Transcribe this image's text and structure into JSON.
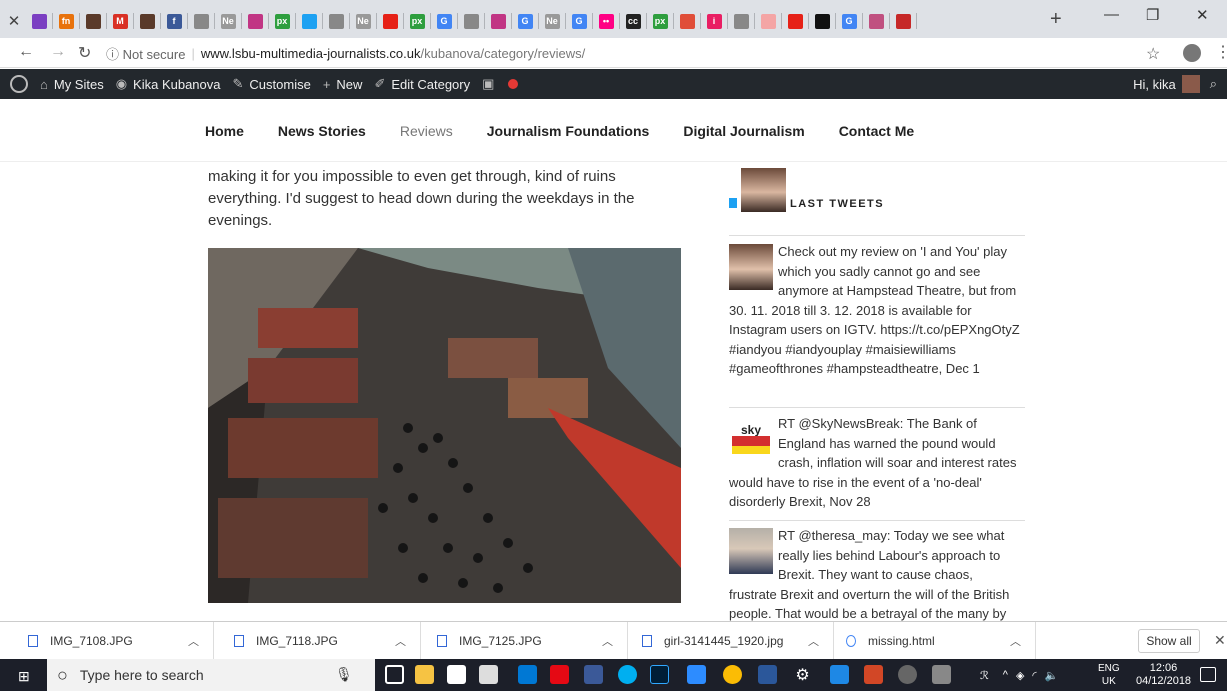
{
  "browser": {
    "tab_icons": [
      {
        "name": "purple-icon",
        "color": "#7b3fc2",
        "glyph": ""
      },
      {
        "name": "fn-icon",
        "color": "#e8720c",
        "glyph": "fn"
      },
      {
        "name": "profile-icon",
        "color": "#5a3a2a",
        "glyph": ""
      },
      {
        "name": "gmail-icon",
        "color": "#d93025",
        "glyph": "M"
      },
      {
        "name": "profile-icon",
        "color": "#5a3a2a",
        "glyph": ""
      },
      {
        "name": "facebook-icon",
        "color": "#3b5998",
        "glyph": "f"
      },
      {
        "name": "doc-icon",
        "color": "#888888",
        "glyph": ""
      },
      {
        "name": "news-icon",
        "color": "#999999",
        "glyph": "Ne"
      },
      {
        "name": "instagram-icon",
        "color": "#c13584",
        "glyph": ""
      },
      {
        "name": "px-icon",
        "color": "#2e9e3e",
        "glyph": "px"
      },
      {
        "name": "twitter-icon",
        "color": "#1da1f2",
        "glyph": ""
      },
      {
        "name": "audio-icon",
        "color": "#888888",
        "glyph": ""
      },
      {
        "name": "news-icon",
        "color": "#999999",
        "glyph": "Ne"
      },
      {
        "name": "youtube-icon",
        "color": "#e62117",
        "glyph": ""
      },
      {
        "name": "px-icon",
        "color": "#2e9e3e",
        "glyph": "px"
      },
      {
        "name": "google-icon",
        "color": "#4285f4",
        "glyph": "G"
      },
      {
        "name": "doc-icon",
        "color": "#888888",
        "glyph": ""
      },
      {
        "name": "instagram-icon",
        "color": "#c13584",
        "glyph": ""
      },
      {
        "name": "google-icon",
        "color": "#4285f4",
        "glyph": "G"
      },
      {
        "name": "news-icon",
        "color": "#999999",
        "glyph": "Ne"
      },
      {
        "name": "google-icon",
        "color": "#4285f4",
        "glyph": "G"
      },
      {
        "name": "flickr-icon",
        "color": "#ff0084",
        "glyph": "••"
      },
      {
        "name": "cc-icon",
        "color": "#222222",
        "glyph": "cc"
      },
      {
        "name": "px-icon",
        "color": "#2e9e3e",
        "glyph": "px"
      },
      {
        "name": "app-icon",
        "color": "#e04e39",
        "glyph": ""
      },
      {
        "name": "info-icon",
        "color": "#e91e63",
        "glyph": "i"
      },
      {
        "name": "doc-icon",
        "color": "#888888",
        "glyph": ""
      },
      {
        "name": "pdf-icon",
        "color": "#f4a5a5",
        "glyph": ""
      },
      {
        "name": "youtube-icon",
        "color": "#e62117",
        "glyph": ""
      },
      {
        "name": "flag-icon",
        "color": "#111111",
        "glyph": ""
      },
      {
        "name": "google-icon",
        "color": "#4285f4",
        "glyph": "G"
      },
      {
        "name": "app-icon",
        "color": "#c05080",
        "glyph": ""
      },
      {
        "name": "red-circle-icon",
        "color": "#c62828",
        "glyph": ""
      }
    ],
    "address": {
      "security": "ⓘ Not secure",
      "host": "www.lsbu-multimedia-journalists.co.uk",
      "path": "/kubanova/category/reviews/"
    }
  },
  "wp_bar": {
    "my_sites": "My Sites",
    "site_name": "Kika Kubanova",
    "customise": "Customise",
    "new": "New",
    "edit_category": "Edit Category",
    "greeting": "Hi, kika"
  },
  "site_nav": [
    "Home",
    "News Stories",
    "Reviews",
    "Journalism Foundations",
    "Digital Journalism",
    "Contact Me"
  ],
  "article": {
    "text": "making it for you impossible to even get through, kind of ruins everything. I'd suggest to head down during the weekdays in the evenings."
  },
  "sidebar": {
    "widget_title": "LAST TWEETS",
    "tweets": [
      {
        "text": "Check out my review on 'I and You' play which you sadly cannot go and see anymore at Hampstead Theatre, but from 30. 11. 2018 till 3. 12. 2018 is available for Instagram users on IGTV. https://t.co/pEPXngOtyZ #iandyou #iandyouplay #maisiewilliams #gameofthrones #hampsteadtheatre, Dec 1"
      },
      {
        "text": "RT @SkyNewsBreak: The Bank of England has warned the pound would crash, inflation will soar and interest rates would have to rise in the event of a 'no-deal' disorderly Brexit, Nov 28"
      },
      {
        "text": "RT @theresa_may: Today we see what really lies behind Labour's approach to Brexit. They want to cause chaos, frustrate Brexit and overturn the will of the British people. That would be a betrayal of the many by"
      }
    ]
  },
  "downloads": {
    "items": [
      "IMG_7108.JPG",
      "IMG_7118.JPG",
      "IMG_7125.JPG",
      "girl-3141445_1920.jpg",
      "missing.html"
    ],
    "show_all": "Show all"
  },
  "taskbar": {
    "search_placeholder": "Type here to search",
    "lang": "ENG",
    "region": "UK",
    "time": "12:06",
    "date": "04/12/2018"
  }
}
